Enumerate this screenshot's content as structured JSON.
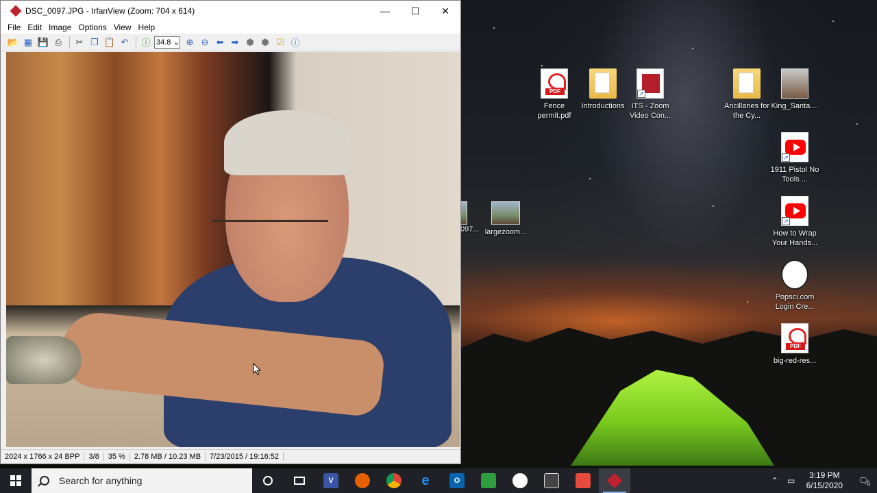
{
  "window": {
    "title": "DSC_0097.JPG - IrfanView (Zoom: 704 x 614)",
    "menu": [
      "File",
      "Edit",
      "Image",
      "Options",
      "View",
      "Help"
    ],
    "zoom_value": "34.8",
    "status": {
      "dimensions": "2024 x 1766 x 24 BPP",
      "index": "3/8",
      "zoom": "35 %",
      "size": "2.78 MB / 10.23 MB",
      "datetime": "7/23/2015 / 19:16:52"
    }
  },
  "desktop": {
    "icons": [
      {
        "label": "Fence permit.pdf",
        "icon": "pdf-icon"
      },
      {
        "label": "Introductions",
        "icon": "folder-icon"
      },
      {
        "label": "ITS - Zoom Video Con...",
        "icon": "zoom-app-icon"
      },
      {
        "label": "Ancillaries for the Cy...",
        "icon": "folder-icon"
      },
      {
        "label": "King_Santa....",
        "icon": "image-icon"
      },
      {
        "label": "1911 Pistol No Tools ...",
        "icon": "youtube-icon"
      },
      {
        "label": "How to Wrap Your Hands...",
        "icon": "youtube-icon"
      },
      {
        "label": "Popsci.com Login Cre...",
        "icon": "text-file-icon"
      },
      {
        "label": "big-red-res...",
        "icon": "pdf-icon"
      },
      {
        "label": "largezoom...",
        "icon": "image-icon"
      },
      {
        "label": "097....",
        "icon": "image-icon"
      }
    ]
  },
  "taskbar": {
    "search_placeholder": "Search for anything",
    "time": "3:19 PM",
    "date": "6/15/2020",
    "notification_count": "5"
  }
}
